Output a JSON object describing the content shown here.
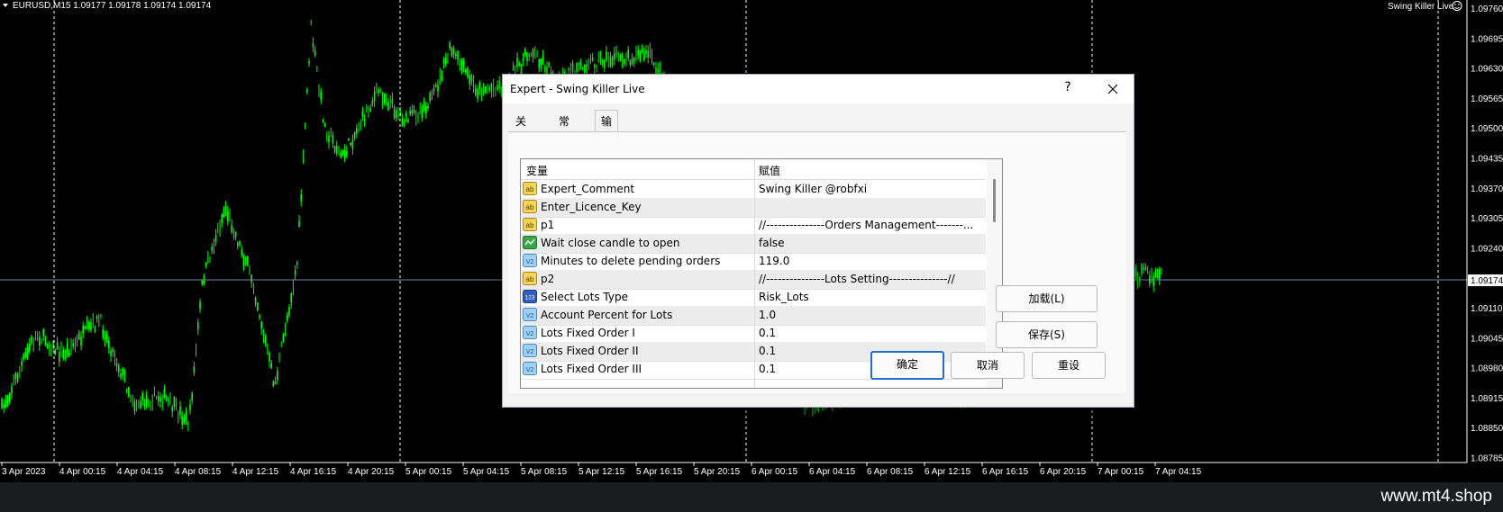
{
  "chart": {
    "symbol_info": "EURUSD,M15  1.09177 1.09178 1.09174 1.09174",
    "ea_label": "Swing Killer Live",
    "current_price": "1.09174",
    "price_labels": [
      "1.09760",
      "1.09695",
      "1.09630",
      "1.09565",
      "1.09500",
      "1.09435",
      "1.09370",
      "1.09305",
      "1.09240",
      "1.09174",
      "1.09110",
      "1.09045",
      "1.08980",
      "1.08915",
      "1.08850",
      "1.08785"
    ],
    "time_labels": [
      "3 Apr 2023",
      "4 Apr 00:15",
      "4 Apr 04:15",
      "4 Apr 08:15",
      "4 Apr 12:15",
      "4 Apr 16:15",
      "4 Apr 20:15",
      "5 Apr 00:15",
      "5 Apr 04:15",
      "5 Apr 08:15",
      "5 Apr 12:15",
      "5 Apr 16:15",
      "5 Apr 20:15",
      "6 Apr 00:15",
      "6 Apr 04:15",
      "6 Apr 08:15",
      "6 Apr 12:15",
      "6 Apr 16:15",
      "6 Apr 20:15",
      "7 Apr 00:15",
      "7 Apr 04:15"
    ],
    "colors": {
      "background": "#000000",
      "candle": "#00ff00",
      "grid": "#ffffff",
      "bid_line": "#7a8aa8"
    }
  },
  "dialog": {
    "title": "Expert - Swing Killer Live",
    "help": "?",
    "tabs": [
      "关于",
      "常用",
      "输入参数"
    ],
    "active_tab": 2,
    "columns": {
      "variable": "变量",
      "value": "赋值"
    },
    "rows": [
      {
        "icon": "ab",
        "name": "Expert_Comment",
        "value": "Swing Killer @robfxi"
      },
      {
        "icon": "ab",
        "name": "Enter_Licence_Key",
        "value": ""
      },
      {
        "icon": "ab",
        "name": "p1",
        "value": "//---------------Orders Management-------..."
      },
      {
        "icon": "bool",
        "name": "Wait close candle to open",
        "value": "false"
      },
      {
        "icon": "num",
        "name": "Minutes to delete pending orders",
        "value": "119.0"
      },
      {
        "icon": "ab",
        "name": "p2",
        "value": "//---------------Lots Setting---------------//"
      },
      {
        "icon": "enum",
        "name": "Select Lots Type",
        "value": "Risk_Lots"
      },
      {
        "icon": "num",
        "name": "Account Percent for Lots",
        "value": "1.0"
      },
      {
        "icon": "num",
        "name": "Lots Fixed Order I",
        "value": "0.1"
      },
      {
        "icon": "num",
        "name": "Lots Fixed Order II",
        "value": "0.1"
      },
      {
        "icon": "num",
        "name": "Lots Fixed Order III",
        "value": "0.1"
      }
    ],
    "buttons": {
      "load": "加载(L)",
      "save": "保存(S)",
      "ok": "确定",
      "cancel": "取消",
      "reset": "重设"
    }
  },
  "watermark": "www.mt4.shop"
}
